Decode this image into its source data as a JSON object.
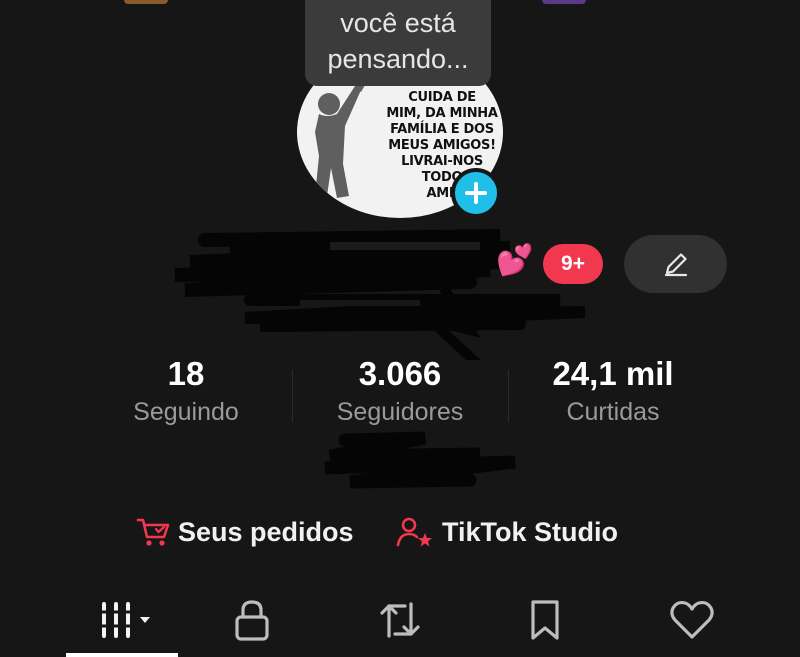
{
  "tooltip": {
    "text": "você está\npensando..."
  },
  "avatar": {
    "text": "CUIDA DE\nMIM, DA MINHA\nFAMÍLIA E DOS\nMEUS AMIGOS!\nLIVRAI-NOS\nTODO\nAMÉ"
  },
  "profile": {
    "hearts_emoji": "💕",
    "notification_badge": "9+"
  },
  "stats": [
    {
      "value": "18",
      "label": "Seguindo"
    },
    {
      "value": "3.066",
      "label": "Seguidores"
    },
    {
      "value": "24,1 mil",
      "label": "Curtidas"
    }
  ],
  "links": {
    "orders": "Seus pedidos",
    "studio": "TikTok Studio"
  },
  "colors": {
    "background": "#161616",
    "accent_pink": "#f1384f",
    "add_blue": "#20bfe8"
  },
  "icons": {
    "edit": "pencil-icon",
    "add": "plus-icon",
    "orders": "cart-icon",
    "studio": "person-star-icon",
    "tabs": [
      "grid-icon",
      "lock-icon",
      "repost-icon",
      "bookmark-icon",
      "heart-icon"
    ]
  }
}
